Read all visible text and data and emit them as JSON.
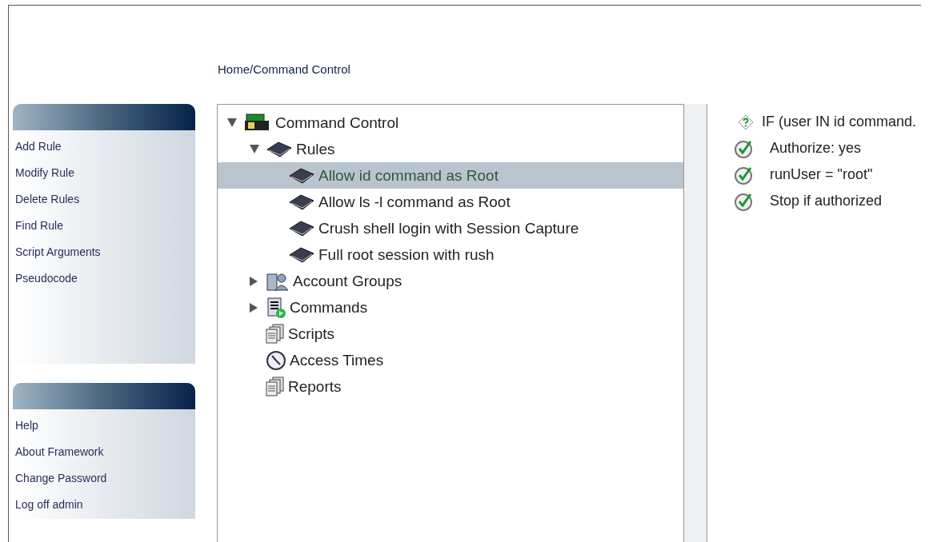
{
  "breadcrumb": "Home/Command Control",
  "sidebar": {
    "panels": [
      {
        "items": [
          "Add Rule",
          "Modify Rule",
          "Delete Rules",
          "Find Rule",
          "Script Arguments",
          "Pseudocode"
        ]
      },
      {
        "items": [
          "Help",
          "About Framework",
          "Change Password",
          "Log off admin"
        ]
      }
    ]
  },
  "tree": [
    {
      "label": "Command Control",
      "kind": "root",
      "expandable": true,
      "expanded": true,
      "selected": false,
      "children": [
        {
          "label": "Rules",
          "kind": "rule",
          "expandable": true,
          "expanded": true,
          "selected": false,
          "children": [
            {
              "label": "Allow id command as Root",
              "kind": "rule",
              "expandable": false,
              "expanded": false,
              "selected": true
            },
            {
              "label": "Allow ls -l command as Root",
              "kind": "rule",
              "expandable": false,
              "expanded": false,
              "selected": false
            },
            {
              "label": "Crush shell login with Session Capture",
              "kind": "rule",
              "expandable": false,
              "expanded": false,
              "selected": false
            },
            {
              "label": "Full root session with rush",
              "kind": "rule",
              "expandable": false,
              "expanded": false,
              "selected": false
            }
          ]
        },
        {
          "label": "Account Groups",
          "kind": "group",
          "expandable": true,
          "expanded": false,
          "selected": false
        },
        {
          "label": "Commands",
          "kind": "commands",
          "expandable": true,
          "expanded": false,
          "selected": false
        },
        {
          "label": "Scripts",
          "kind": "pages",
          "expandable": false,
          "expanded": false,
          "selected": false
        },
        {
          "label": "Access Times",
          "kind": "clock",
          "expandable": false,
          "expanded": false,
          "selected": false
        },
        {
          "label": "Reports",
          "kind": "pages",
          "expandable": false,
          "expanded": false,
          "selected": false
        }
      ]
    }
  ],
  "rule_detail": [
    {
      "kind": "condition",
      "text": "IF (user IN id command."
    },
    {
      "kind": "action",
      "text": "Authorize: yes"
    },
    {
      "kind": "action",
      "text": "runUser = \"root\""
    },
    {
      "kind": "action",
      "text": "Stop if authorized"
    }
  ]
}
